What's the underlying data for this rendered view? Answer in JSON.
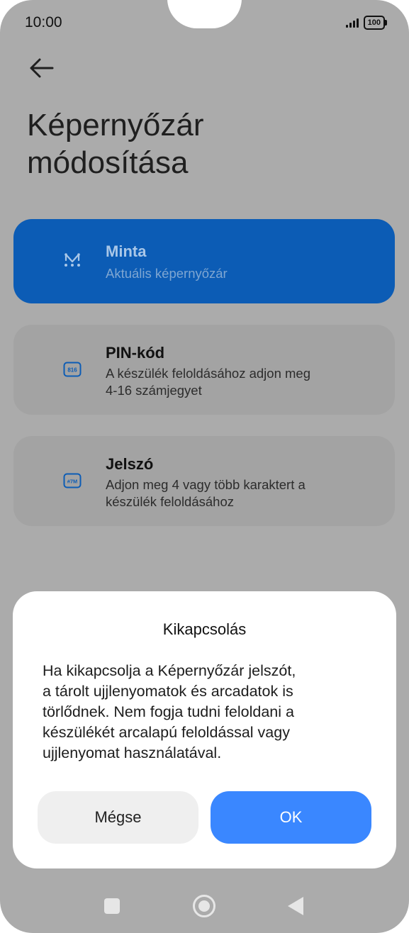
{
  "status_bar": {
    "time": "10:00",
    "battery": "100"
  },
  "header": {
    "back_icon": "arrow-left-icon",
    "title_line1": "Képernyőzár",
    "title_line2": "módosítása"
  },
  "options": [
    {
      "title": "Minta",
      "description": "Aktuális képernyőzár",
      "icon": "pattern-icon",
      "selected": true
    },
    {
      "title": "PIN-kód",
      "description_line1": "A készülék feloldásához adjon meg",
      "description_line2": "4-16 számjegyet",
      "icon": "pin-icon",
      "icon_text": "816"
    },
    {
      "title": "Jelszó",
      "description_line1": "Adjon meg 4 vagy több karaktert a",
      "description_line2": "készülék feloldásához",
      "icon": "password-icon",
      "icon_text": "#7M"
    }
  ],
  "dialog": {
    "title": "Kikapcsolás",
    "body_lines": [
      "Ha kikapcsolja a Képernyőzár jelszót,",
      "a tárolt ujjlenyomatok és arcadatok is",
      "törlődnek. Nem fogja tudni feloldani a",
      "készülékét arcalapú feloldással vagy",
      "ujjlenyomat használatával."
    ],
    "cancel_label": "Mégse",
    "ok_label": "OK"
  },
  "colors": {
    "accent": "#0c5cb5",
    "ok_button": "#3a87ff",
    "scrim": "#ababab"
  },
  "navbar": {
    "icons": [
      "recents-square-icon",
      "home-circle-icon",
      "back-triangle-icon"
    ]
  }
}
